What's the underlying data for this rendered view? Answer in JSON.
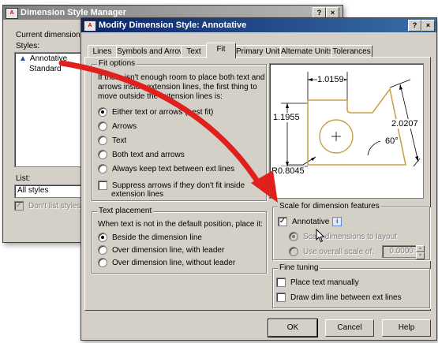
{
  "back_window": {
    "title": "Dimension Style Manager",
    "help_button": "?",
    "close_button": "×",
    "current_style_label": "Current dimension style",
    "styles_label": "Styles:",
    "styles": [
      "Annotative",
      "Standard"
    ],
    "list_label": "List:",
    "list_value": "All styles",
    "dont_list_label": "Don't list styles in X"
  },
  "dialog": {
    "title": "Modify Dimension Style: Annotative",
    "help_button": "?",
    "close_button": "×",
    "tabs": [
      "Lines",
      "Symbols and Arrows",
      "Text",
      "Fit",
      "Primary Units",
      "Alternate Units",
      "Tolerances"
    ],
    "active_tab": "Fit",
    "fit_options": {
      "title": "Fit options",
      "desc": [
        "If there isn't enough room to place both text and",
        "arrows inside extension lines, the first thing to",
        "move outside the extension lines is:"
      ],
      "options": [
        "Either text or arrows (best fit)",
        "Arrows",
        "Text",
        "Both text and arrows",
        "Always keep text between ext lines"
      ],
      "suppress": [
        "Suppress arrows if they don't fit inside",
        "extension lines"
      ]
    },
    "text_placement": {
      "title": "Text placement",
      "desc": "When text is not in the default position, place it:",
      "options": [
        "Beside the dimension line",
        "Over dimension line, with leader",
        "Over dimension line, without leader"
      ]
    },
    "preview": {
      "dim_top": "1.0159",
      "dim_left": "1.1955",
      "dim_right": "2.0207",
      "dim_angle": "60°",
      "dim_radius": "R0.8045"
    },
    "scale": {
      "title": "Scale for dimension features",
      "annotative_label": "Annotative",
      "scale_to_layout": "Scale dimensions to layout",
      "use_overall": "Use overall scale of:",
      "overall_value": "0.0000"
    },
    "fine_tuning": {
      "title": "Fine tuning",
      "place_text": "Place text manually",
      "draw_dim": "Draw dim line between ext lines"
    },
    "buttons": {
      "ok": "OK",
      "cancel": "Cancel",
      "help": "Help"
    }
  },
  "colors": {
    "titlebar": "#0a246a",
    "arrow": "#e0201c",
    "part_outline": "#c8a24a"
  }
}
